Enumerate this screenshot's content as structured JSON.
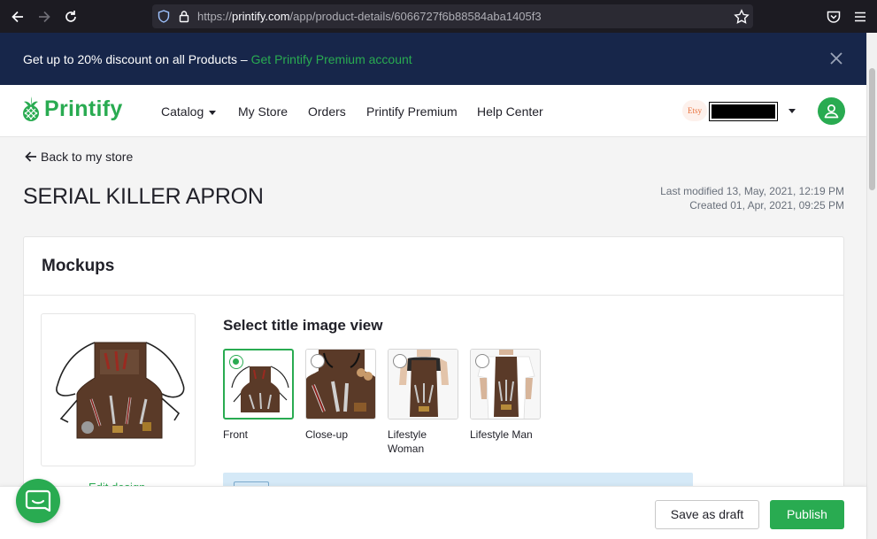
{
  "browser": {
    "url_prefix": "https://",
    "url_host": "printify.com",
    "url_path": "/app/product-details/6066727f6b88584aba1405f3"
  },
  "promo": {
    "text": "Get up to 20% discount on all Products – ",
    "link": "Get Printify Premium account"
  },
  "header": {
    "logo_text": "Printify",
    "nav": [
      {
        "label": "Catalog"
      },
      {
        "label": "My Store"
      },
      {
        "label": "Orders"
      },
      {
        "label": "Printify Premium"
      },
      {
        "label": "Help Center"
      }
    ],
    "store_badge": "Etsy"
  },
  "page": {
    "back_label": "Back to my store",
    "title": "SERIAL KILLER APRON",
    "last_modified": "Last modified 13, May, 2021, 12:19 PM",
    "created": "Created 01, Apr, 2021, 09:25 PM"
  },
  "mockups": {
    "title": "Mockups",
    "edit_design": "Edit design",
    "select_title": "Select title image view",
    "views": [
      {
        "label": "Front",
        "selected": true
      },
      {
        "label": "Close-up",
        "selected": false
      },
      {
        "label": "Lifestyle Woman",
        "selected": false
      },
      {
        "label": "Lifestyle Man",
        "selected": false
      }
    ]
  },
  "footer": {
    "save_draft": "Save as draft",
    "publish": "Publish"
  },
  "colors": {
    "brand_green": "#29ab51",
    "banner_navy": "#17264a",
    "info_blue": "#d5e9f7"
  }
}
